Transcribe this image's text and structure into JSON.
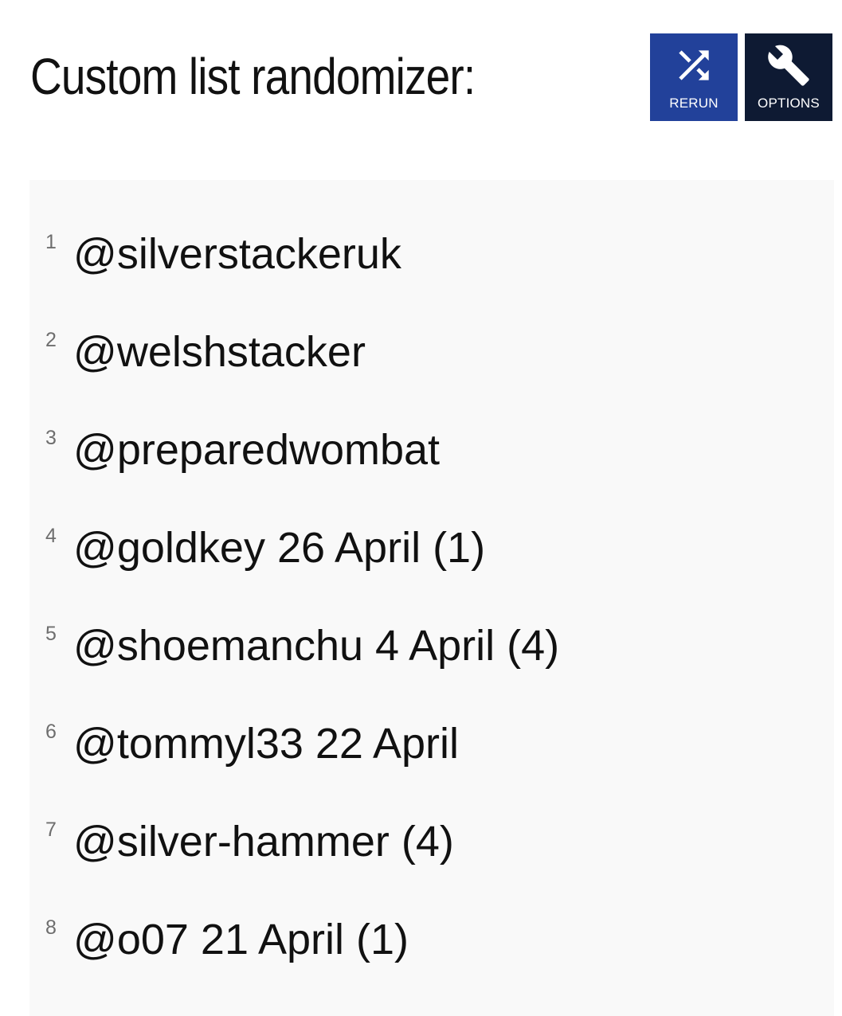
{
  "header": {
    "title": "Custom list randomizer:"
  },
  "toolbar": {
    "rerun_label": "RERUN",
    "rerun_icon": "shuffle-icon",
    "options_label": "OPTIONS",
    "options_icon": "wrench-icon"
  },
  "colors": {
    "rerun_button": "#22419a",
    "options_button": "#0e1a33",
    "panel_background": "#f9f9f9"
  },
  "results": {
    "items": [
      {
        "number": "1",
        "text": "@silverstackeruk"
      },
      {
        "number": "2",
        "text": "@welshstacker"
      },
      {
        "number": "3",
        "text": "@preparedwombat"
      },
      {
        "number": "4",
        "text": "@goldkey 26 April (1)"
      },
      {
        "number": "5",
        "text": "@shoemanchu 4 April (4)"
      },
      {
        "number": "6",
        "text": "@tommyl33 22 April"
      },
      {
        "number": "7",
        "text": "@silver-hammer (4)"
      },
      {
        "number": "8",
        "text": "@o07 21 April (1)"
      }
    ]
  }
}
